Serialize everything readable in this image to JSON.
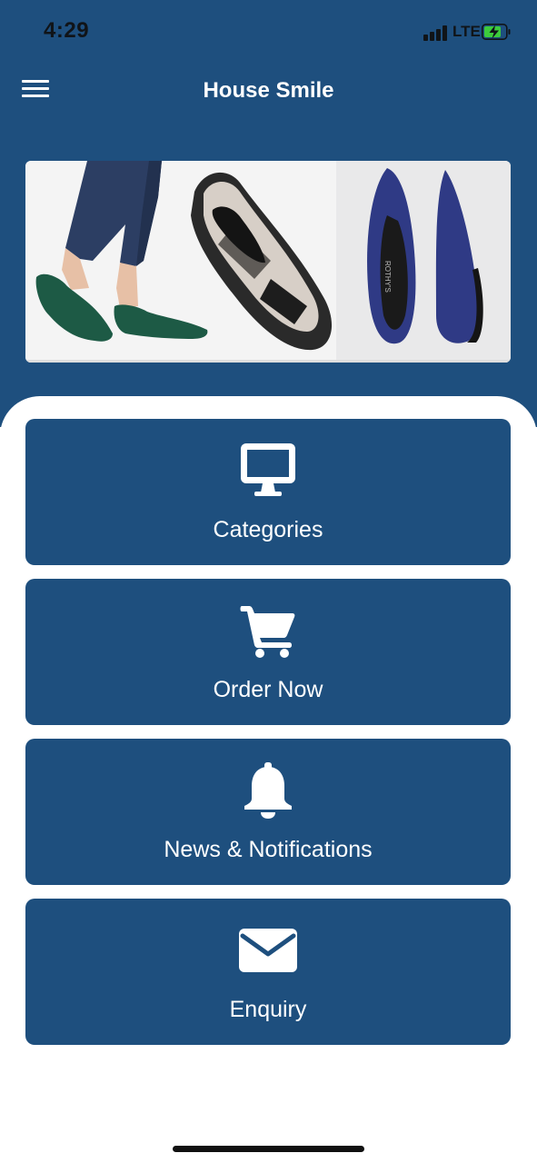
{
  "status_bar": {
    "time": "4:29",
    "network": "LTE",
    "battery_charging": true,
    "battery_color": "#3ccb3c"
  },
  "app_bar": {
    "title": "House Smile",
    "menu_icon": "hamburger-menu-icon"
  },
  "colors": {
    "primary": "#1e4f7e",
    "surface": "#ffffff",
    "text_on_primary": "#ffffff"
  },
  "banner": {
    "description_icon": "shoe-banner-image",
    "brand_text": "ROTHY'S"
  },
  "menu_tiles": [
    {
      "label": "Categories",
      "icon": "monitor-icon"
    },
    {
      "label": "Order Now",
      "icon": "shopping-cart-icon"
    },
    {
      "label": "News & Notifications",
      "icon": "bell-icon"
    },
    {
      "label": "Enquiry",
      "icon": "envelope-icon"
    }
  ]
}
